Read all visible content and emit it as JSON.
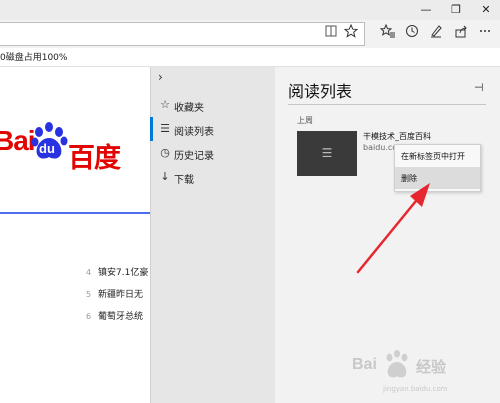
{
  "window": {
    "minimize_glyph": "—",
    "restore_glyph": "❐",
    "close_glyph": "✕"
  },
  "toolbar": {
    "icons": [
      "reading-view-icon",
      "favorite-star-icon",
      "favorites-hub-icon",
      "history-clock-icon",
      "pen-icon",
      "share-icon",
      "more-icon"
    ]
  },
  "status": {
    "text": "0磁盘占用100%"
  },
  "page": {
    "logo_left": "Bai",
    "logo_paw_text": "du",
    "logo_right": "百度",
    "news": [
      {
        "num": "4",
        "text": "镇安7.1亿豪"
      },
      {
        "num": "5",
        "text": "新疆昨日无"
      },
      {
        "num": "6",
        "text": "葡萄牙总统"
      }
    ]
  },
  "hub": {
    "expand_glyph": "›",
    "nav": [
      {
        "label": "收藏夹",
        "icon": "star-outline-icon"
      },
      {
        "label": "阅读列表",
        "icon": "reading-list-icon"
      },
      {
        "label": "历史记录",
        "icon": "history-icon"
      },
      {
        "label": "下载",
        "icon": "download-icon"
      }
    ],
    "title": "阅读列表",
    "pin_glyph": "⊣",
    "group_label": "上周",
    "item": {
      "title": "干模技术_百度百科",
      "domain": "baidu.co"
    }
  },
  "context_menu": {
    "items": [
      "在新标签页中打开",
      "删除"
    ]
  },
  "watermark": {
    "left": "Bai",
    "right": "经验",
    "url": "jingyan.baidu.com"
  },
  "colors": {
    "baidu_red": "#e10601",
    "baidu_blue": "#2932e1",
    "accent": "#0078d7",
    "arrow_red": "#e8262f"
  }
}
